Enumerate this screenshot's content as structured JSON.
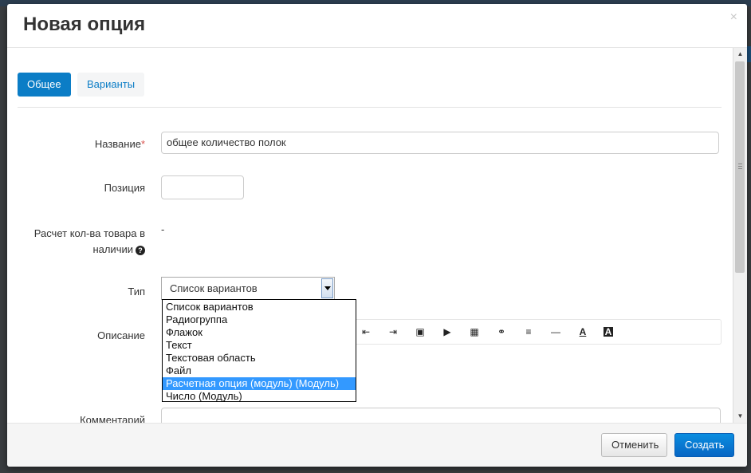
{
  "modal": {
    "title": "Новая опция",
    "close_symbol": "×"
  },
  "tabs": [
    {
      "label": "Общее",
      "active": true
    },
    {
      "label": "Варианты",
      "active": false
    }
  ],
  "form": {
    "name": {
      "label": "Название",
      "required_mark": "*",
      "value": "общее количество полок"
    },
    "position": {
      "label": "Позиция",
      "value": ""
    },
    "stock_calc": {
      "label_line1": "Расчет кол-ва товара в",
      "label_line2": "наличии",
      "help_symbol": "?",
      "value": "-"
    },
    "type": {
      "label": "Тип",
      "selected": "Список вариантов",
      "options": [
        "Список вариантов",
        "Радиогруппа",
        "Флажок",
        "Текст",
        "Текстовая область",
        "Файл",
        "Расчетная опция (модуль) (Модуль)",
        "Число (Модуль)"
      ],
      "highlighted_option": "Расчетная опция (модуль) (Модуль)"
    },
    "description": {
      "label": "Описание"
    },
    "comment": {
      "label": "Комментарий"
    }
  },
  "editor_toolbar": {
    "icons": [
      "outdent-icon",
      "indent-icon",
      "image-icon",
      "video-icon",
      "table-icon",
      "link-icon",
      "align-icon",
      "horizontal-rule-icon",
      "font-color-icon",
      "background-color-icon"
    ],
    "glyphs": [
      "⇤",
      "⇥",
      "▣",
      "▶",
      "▦",
      "⚭",
      "≡",
      "—",
      "A",
      "A"
    ]
  },
  "footer": {
    "cancel_label": "Отменить",
    "create_label": "Создать"
  },
  "colors": {
    "accent": "#0b7dc6",
    "primary_button": "#0866c4",
    "highlight": "#3399ff",
    "required": "#d9534f"
  }
}
